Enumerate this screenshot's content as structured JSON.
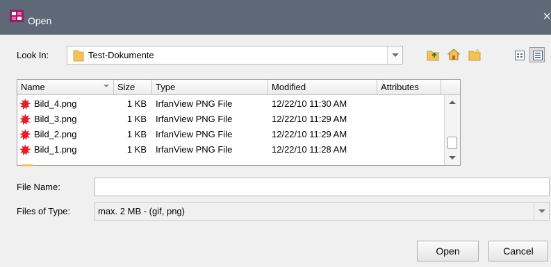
{
  "window": {
    "title": "Open",
    "close_glyph": "×"
  },
  "look_in": {
    "label": "Look In:",
    "value": "Test-Dokumente"
  },
  "toolbar": {
    "icons": [
      "up-folder-icon",
      "home-icon",
      "new-folder-icon",
      "list-view-icon",
      "details-view-icon"
    ],
    "active_view": "details"
  },
  "table": {
    "columns": [
      "Name",
      "Size",
      "Type",
      "Modified",
      "Attributes"
    ],
    "rows": [
      {
        "name": "Bild_4.png",
        "size": "1 KB",
        "type": "IrfanView PNG File",
        "modified": "12/22/10 11:30 AM"
      },
      {
        "name": "Bild_3.png",
        "size": "1 KB",
        "type": "IrfanView PNG File",
        "modified": "12/22/10 11:29 AM"
      },
      {
        "name": "Bild_2.png",
        "size": "1 KB",
        "type": "IrfanView PNG File",
        "modified": "12/22/10 11:29 AM"
      },
      {
        "name": "Bild_1.png",
        "size": "1 KB",
        "type": "IrfanView PNG File",
        "modified": "12/22/10 11:28 AM"
      }
    ]
  },
  "file_name": {
    "label": "File Name:",
    "value": ""
  },
  "file_type": {
    "label": "Files of Type:",
    "value": "max. 2 MB - (gif, png)"
  },
  "buttons": {
    "open": "Open",
    "cancel": "Cancel"
  },
  "colors": {
    "titlebar": "#5f6876",
    "folder": "#f2c25b",
    "png_icon": "#e0202a"
  }
}
